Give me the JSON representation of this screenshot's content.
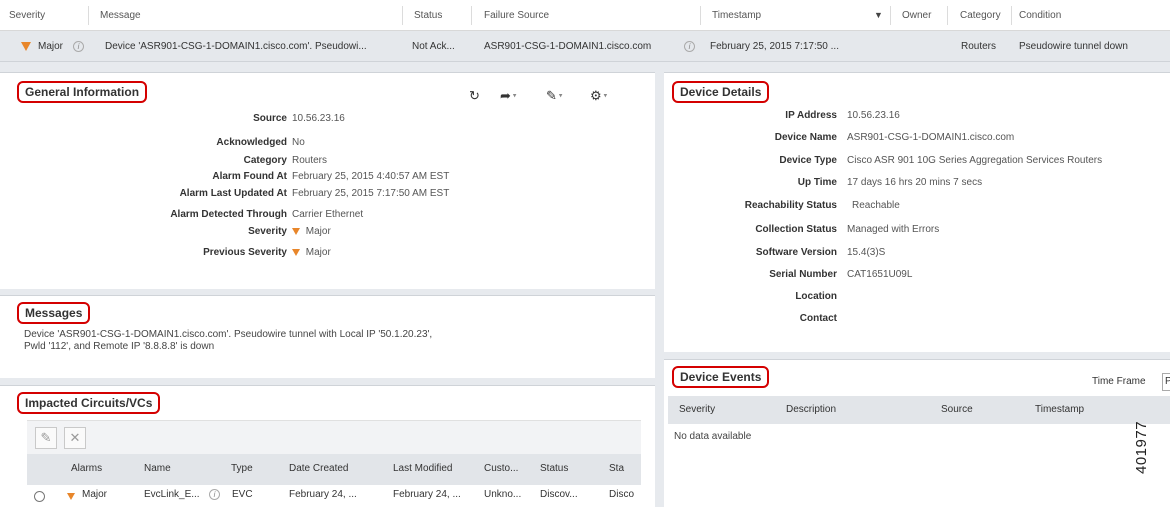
{
  "alarm_table": {
    "headers": [
      "Severity",
      "Message",
      "Status",
      "Failure Source",
      "Timestamp",
      "Owner",
      "Category",
      "Condition"
    ],
    "sort_indicator": "▼",
    "row": {
      "severity": "Major",
      "message": "Device 'ASR901-CSG-1-DOMAIN1.cisco.com'. Pseudowi...",
      "status": "Not Ack...",
      "failure_source": "ASR901-CSG-1-DOMAIN1.cisco.com",
      "timestamp": "February 25, 2015 7:17:50 ...",
      "owner": "",
      "category": "Routers",
      "condition": "Pseudowire tunnel down"
    },
    "severity_color": "#e8862a"
  },
  "general_information": {
    "title": "General Information",
    "fields": [
      {
        "label": "Source",
        "value": "10.56.23.16"
      },
      {
        "label": "Acknowledged",
        "value": "No"
      },
      {
        "label": "Category",
        "value": "Routers"
      },
      {
        "label": "Alarm Found At",
        "value": "February 25, 2015 4:40:57 AM EST"
      },
      {
        "label": "Alarm Last Updated At",
        "value": "February 25, 2015 7:17:50 AM EST"
      },
      {
        "label": "Alarm Detected Through",
        "value": "Carrier Ethernet"
      },
      {
        "label": "Severity",
        "value": "Major"
      },
      {
        "label": "Previous Severity",
        "value": "Major"
      }
    ],
    "toolbar_icons": [
      "refresh-icon",
      "share-arrow-icon",
      "annotate-icon",
      "more-actions-icon"
    ]
  },
  "messages": {
    "title": "Messages",
    "text": "Device 'ASR901-CSG-1-DOMAIN1.cisco.com'. Pseudowire tunnel with Local IP '50.1.20.23', Pwld '112', and Remote IP '8.8.8.8' is down"
  },
  "impacted_circuits": {
    "title": "Impacted Circuits/VCs",
    "headers": [
      "Alarms",
      "Name",
      "Type",
      "Date Created",
      "Last Modified",
      "Custo...",
      "Status",
      "Sta"
    ],
    "rows": [
      {
        "alarm": "Major",
        "name": "EvcLink_E...",
        "type": "EVC",
        "date_created": "February 24, ...",
        "last_modified": "February 24, ...",
        "customer": "Unkno...",
        "status": "Discov...",
        "sta": "Disco"
      }
    ]
  },
  "device_details": {
    "title": "Device Details",
    "fields": [
      {
        "label": "IP Address",
        "value": "10.56.23.16"
      },
      {
        "label": "Device Name",
        "value": "ASR901-CSG-1-DOMAIN1.cisco.com"
      },
      {
        "label": "Device Type",
        "value": "Cisco ASR 901 10G Series Aggregation Services Routers"
      },
      {
        "label": "Up Time",
        "value": "17 days 16 hrs 20 mins 7 secs"
      },
      {
        "label": "Reachability Status",
        "value": "Reachable"
      },
      {
        "label": "Collection Status",
        "value": "Managed with Errors"
      },
      {
        "label": "Software Version",
        "value": "15.4(3)S"
      },
      {
        "label": "Serial Number",
        "value": "CAT1651U09L"
      },
      {
        "label": "Location",
        "value": ""
      },
      {
        "label": "Contact",
        "value": ""
      }
    ]
  },
  "device_events": {
    "title": "Device Events",
    "time_frame_label": "Time Frame",
    "time_frame_value": "P",
    "headers": [
      "Severity",
      "Description",
      "Source",
      "Timestamp"
    ],
    "empty_text": "No data available"
  },
  "figure_number": "401977"
}
